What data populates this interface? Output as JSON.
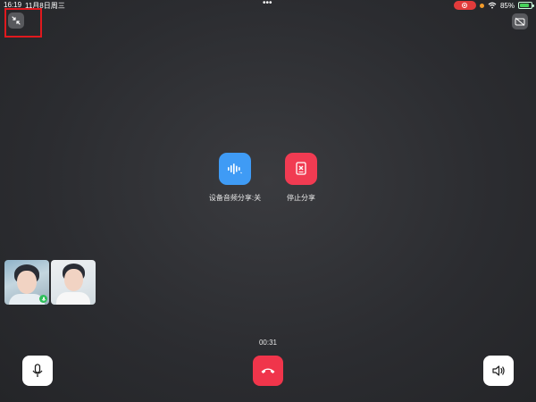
{
  "status_bar": {
    "time": "16:19",
    "date": "11月8日周三",
    "dots": "•••",
    "battery_percent": "85%",
    "battery_level": 0.85,
    "icons": [
      "screen-record-icon",
      "privacy-indicator-icon",
      "wifi-icon",
      "battery-icon"
    ]
  },
  "top_controls": {
    "minimize_icon": "minimize-arrows-icon",
    "camera_icon": "camera-off-icon"
  },
  "actions": {
    "audio_share": {
      "label": "设备音频分享:关",
      "icon": "audio-wave-icon"
    },
    "stop_share": {
      "label": "停止分享",
      "icon": "stop-share-icon"
    }
  },
  "participants": [
    {
      "name": "",
      "mic_on": true
    },
    {
      "name": "",
      "mic_on": false
    }
  ],
  "call": {
    "timer": "00:31"
  },
  "bottom_controls": {
    "mic_icon": "microphone-icon",
    "hangup_icon": "hang-up-icon",
    "speaker_icon": "speaker-icon"
  },
  "colors": {
    "background": "#2b2c30",
    "blue_action": "#3f9bf5",
    "red_action": "#f13b52",
    "hangup": "#f0354b",
    "highlight": "#e0191e",
    "mic_badge": "#2fbf5b"
  }
}
